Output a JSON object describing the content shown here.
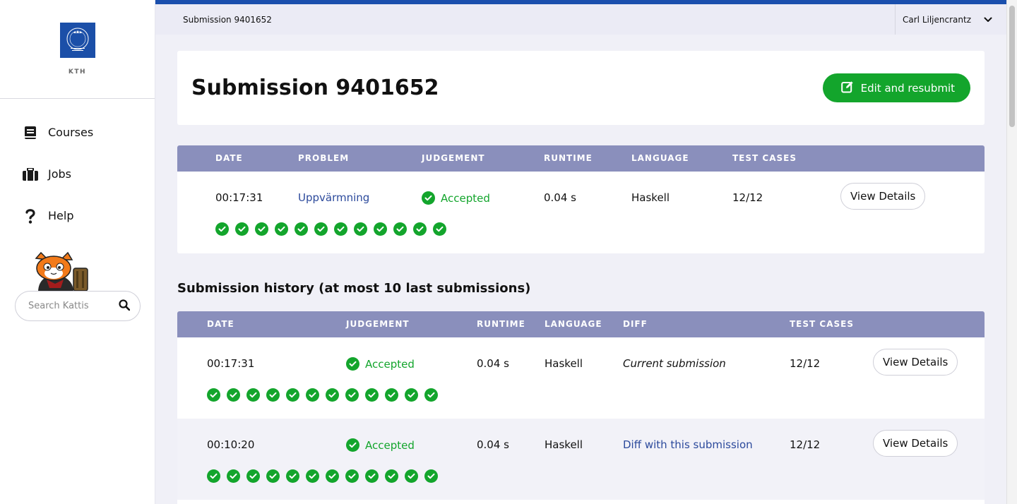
{
  "sidebar": {
    "logo_text": "KTH",
    "logo_label": "KTH",
    "items": [
      {
        "label": "Courses",
        "icon": "book-icon"
      },
      {
        "label": "Jobs",
        "icon": "briefcase-icon"
      },
      {
        "label": "Help",
        "icon": "question-icon"
      }
    ],
    "search_placeholder": "Search Kattis"
  },
  "topbar": {
    "breadcrumb": "Submission 9401652",
    "user_name": "Carl Liljencrantz"
  },
  "header": {
    "title": "Submission 9401652",
    "resubmit_label": "Edit and resubmit"
  },
  "submission": {
    "columns": [
      "DATE",
      "PROBLEM",
      "JUDGEMENT",
      "RUNTIME",
      "LANGUAGE",
      "TEST CASES"
    ],
    "row": {
      "date": "00:17:31",
      "problem": "Uppvärmning",
      "judgement": "Accepted",
      "runtime": "0.04 s",
      "language": "Haskell",
      "test_cases": "12/12",
      "details_label": "View Details",
      "passed_tests": 12
    }
  },
  "history": {
    "title": "Submission history (at most 10 last submissions)",
    "columns": [
      "DATE",
      "JUDGEMENT",
      "RUNTIME",
      "LANGUAGE",
      "DIFF",
      "TEST CASES"
    ],
    "rows": [
      {
        "date": "00:17:31",
        "judgement": "Accepted",
        "runtime": "0.04 s",
        "language": "Haskell",
        "diff": "Current submission",
        "test_cases": "12/12",
        "details_label": "View Details",
        "passed_tests": 12
      },
      {
        "date": "00:10:20",
        "judgement": "Accepted",
        "runtime": "0.04 s",
        "language": "Haskell",
        "diff": "Diff with this submission",
        "test_cases": "12/12",
        "details_label": "View Details",
        "passed_tests": 12
      }
    ]
  },
  "colors": {
    "accent": "#1a4fad",
    "table_header": "#8a8fbc",
    "accepted": "#13a52c",
    "link": "#2c4a9c"
  }
}
